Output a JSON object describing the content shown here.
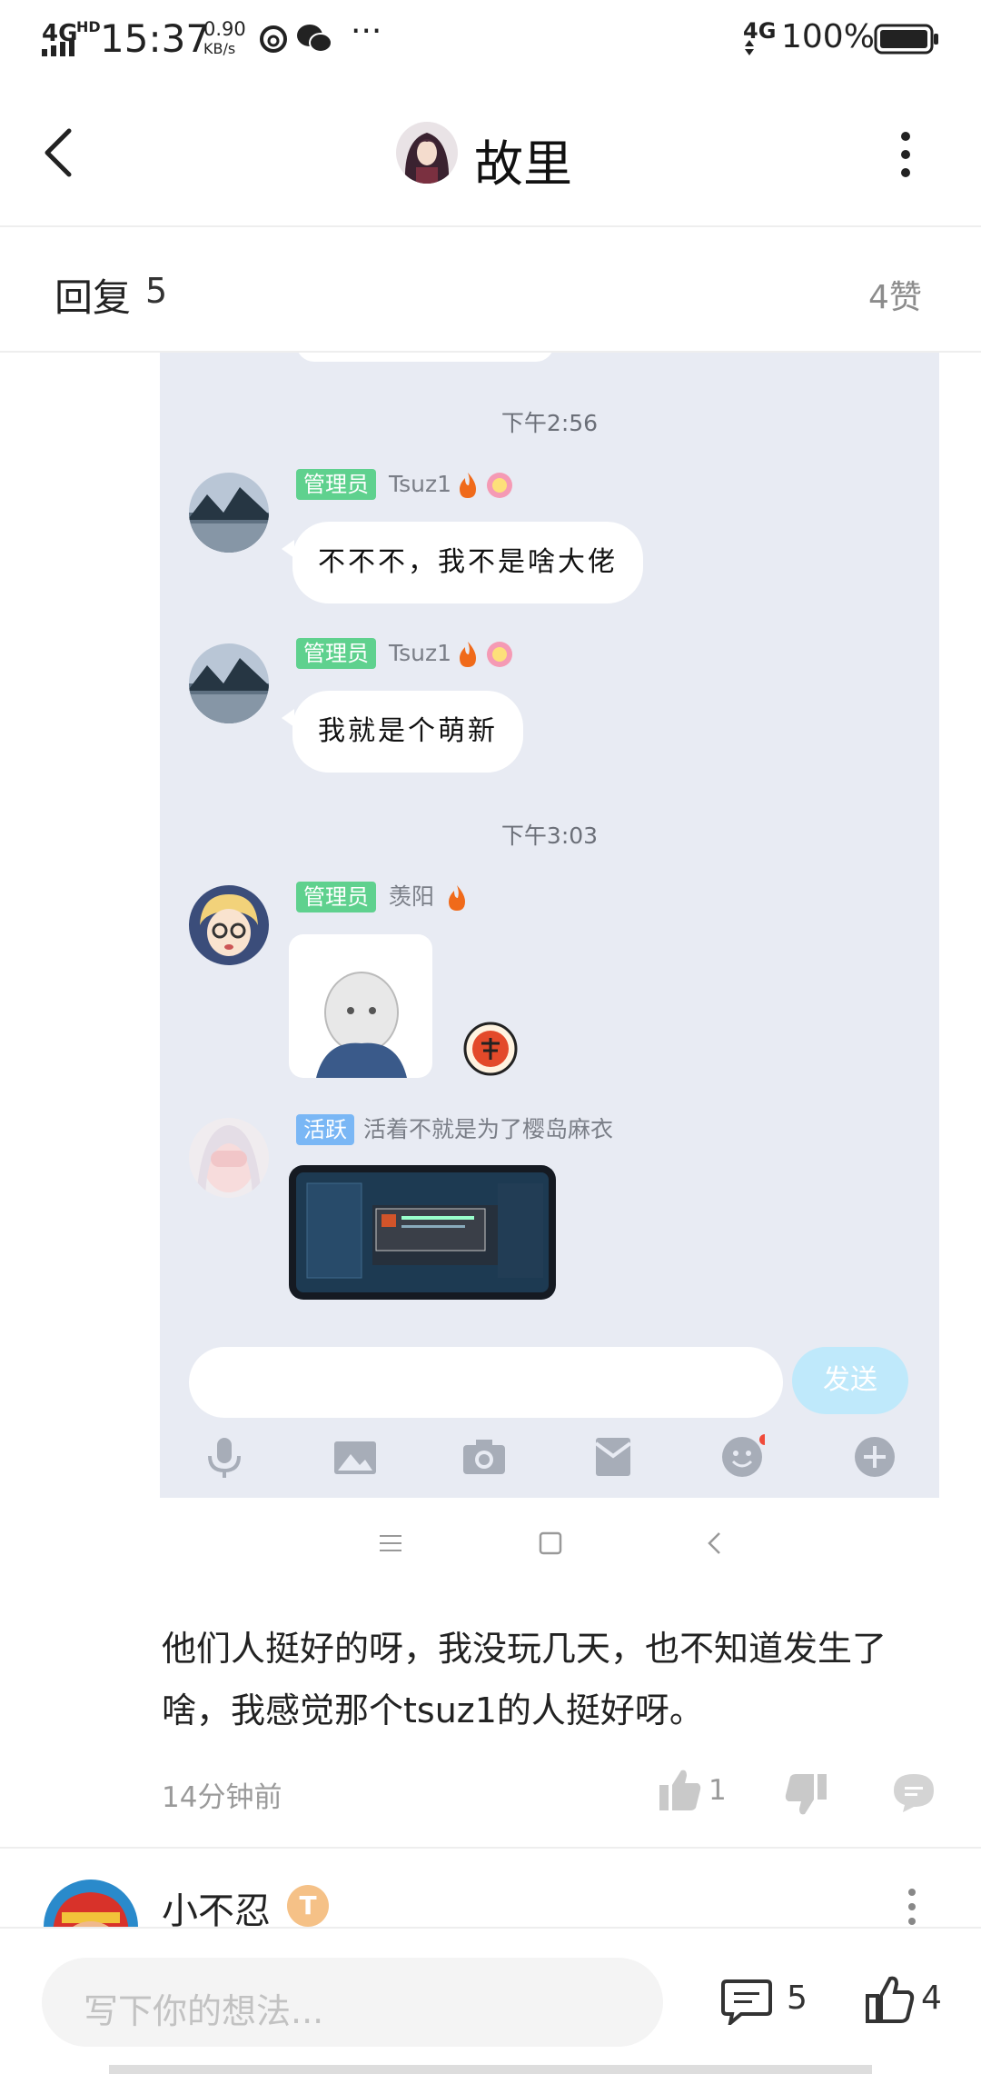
{
  "status_bar": {
    "network": "4G",
    "network_sup": "HD",
    "time": "15:37",
    "speed_value": "0.90",
    "speed_unit": "KB/s",
    "more": "···",
    "signal": "4G",
    "battery": "100%"
  },
  "header": {
    "title": "故里"
  },
  "reply_bar": {
    "label": "回复",
    "count": "5",
    "likes": "4赞"
  },
  "chat": {
    "messages": [
      {
        "time": "下午2:56"
      },
      {
        "badge": "管理员",
        "name": "Tsuz1",
        "text": "不不不，我不是啥大佬"
      },
      {
        "badge": "管理员",
        "name": "Tsuz1",
        "text": "我就是个萌新"
      },
      {
        "time": "下午3:03"
      },
      {
        "badge": "管理员",
        "name": "羡阳"
      },
      {
        "badge": "活跃",
        "name": "活着不就是为了樱岛麻衣"
      }
    ],
    "send_label": "发送",
    "colors": {
      "admin_badge": "#5fd18e",
      "active_badge": "#7ab7f5",
      "send_button": "#bfe9fb"
    }
  },
  "comment": {
    "text": "他们人挺好的呀，我没玩几天，也不知道发生了啥，我感觉那个tsuz1的人挺好呀。",
    "time": "14分钟前",
    "like_count": "1"
  },
  "next_comment": {
    "name": "小不忍",
    "level_badge": "T"
  },
  "bottom_bar": {
    "input_placeholder": "写下你的想法...",
    "comment_count": "5",
    "like_count": "4"
  }
}
